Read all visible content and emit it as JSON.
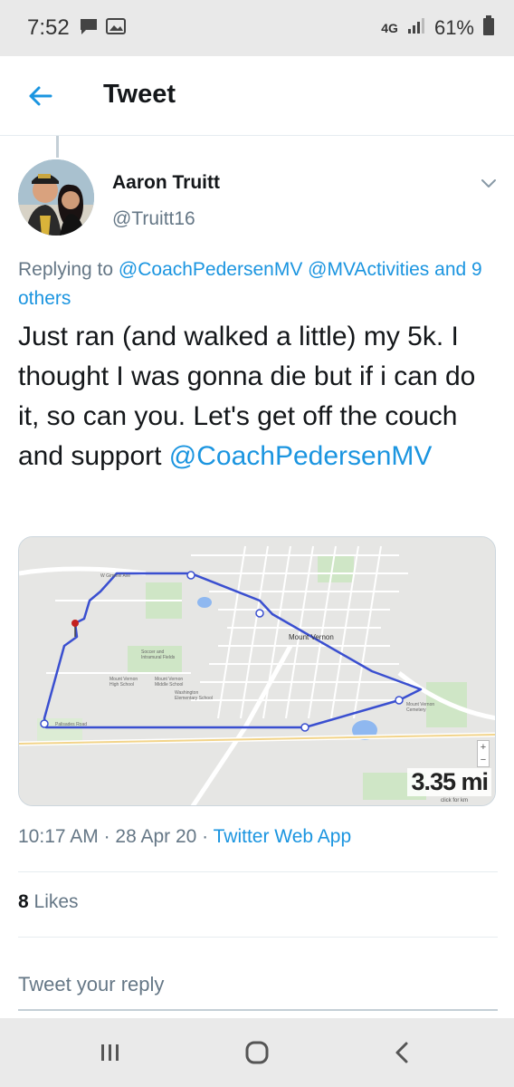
{
  "status_bar": {
    "time": "7:52",
    "network": "4G",
    "battery": "61%",
    "icons": [
      "message-icon",
      "image-icon",
      "signal-icon",
      "battery-icon"
    ]
  },
  "app_bar": {
    "title": "Tweet",
    "back_icon": "arrow-left-icon",
    "accent_color": "#1b95e0"
  },
  "tweet": {
    "author_name": "Aaron Truitt",
    "author_handle": "@Truitt16",
    "replying_prefix": "Replying to ",
    "replying_mention_1": "@CoachPedersenMV",
    "replying_mention_2": "@MVActivities",
    "replying_others": "and 9 others",
    "text": "Just ran (and walked a little) my 5k.  I thought I was gonna die but if i can do it, so can you.  Let's get off the couch and support ",
    "text_mention": "@CoachPedersenMV",
    "time": "10:17 AM",
    "separator": " · ",
    "date": "28 Apr 20",
    "source": "Twitter Web App",
    "likes_count": "8",
    "likes_label": " Likes"
  },
  "map": {
    "distance": "3.35 mi",
    "unit_toggle": "click for km",
    "town_label": "Mount Vernon",
    "route_color": "#3a4fd0",
    "zoom_plus": "+",
    "zoom_minus": "−"
  },
  "reply": {
    "placeholder": "Tweet your reply"
  },
  "nav_bar": {
    "icons": [
      "recent-apps-icon",
      "home-icon",
      "back-icon"
    ]
  }
}
